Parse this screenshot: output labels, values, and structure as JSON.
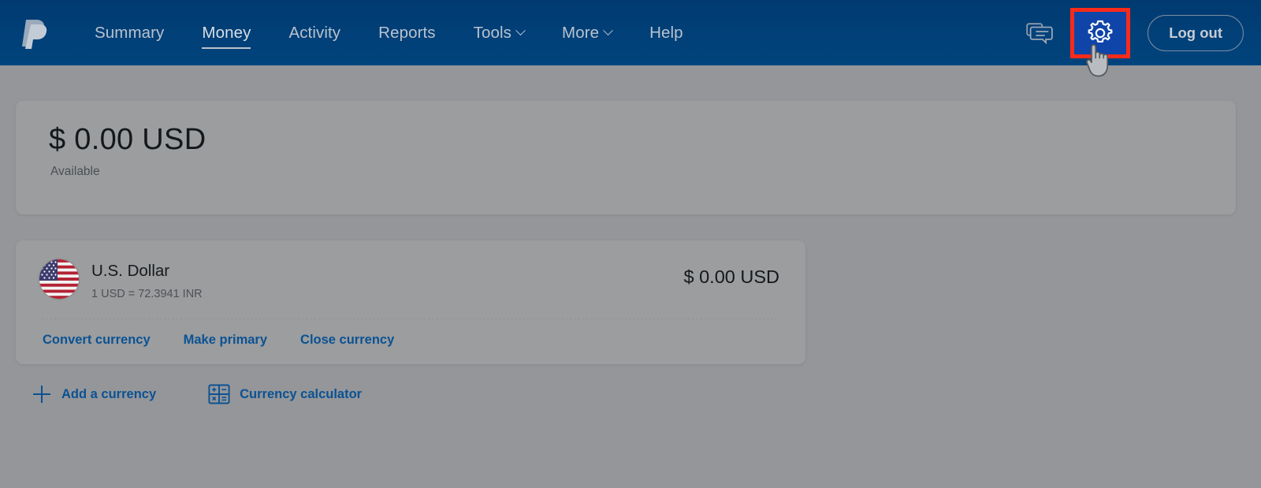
{
  "brand": {
    "logo_name": "paypal-logo",
    "header_bg": "#01437c",
    "link_blue": "#0b5294",
    "highlight_red": "#fb2b19",
    "gear_highlight_bg": "#0f44a8"
  },
  "nav": {
    "items": [
      {
        "label": "Summary",
        "active": false,
        "has_caret": false
      },
      {
        "label": "Money",
        "active": true,
        "has_caret": false
      },
      {
        "label": "Activity",
        "active": false,
        "has_caret": false
      },
      {
        "label": "Reports",
        "active": false,
        "has_caret": false
      },
      {
        "label": "Tools",
        "active": false,
        "has_caret": true
      },
      {
        "label": "More",
        "active": false,
        "has_caret": true
      },
      {
        "label": "Help",
        "active": false,
        "has_caret": false
      }
    ]
  },
  "header_right": {
    "messages_icon": "messages-icon",
    "settings_icon": "gear-icon",
    "logout_label": "Log out"
  },
  "balance": {
    "amount": "$ 0.00 USD",
    "label": "Available"
  },
  "currency": {
    "flag_icon": "us-flag-icon",
    "name": "U.S. Dollar",
    "rate": "1 USD = 72.3941 INR",
    "amount": "$ 0.00 USD",
    "links": [
      {
        "label": "Convert currency"
      },
      {
        "label": "Make primary"
      },
      {
        "label": "Close currency"
      }
    ]
  },
  "bottom_actions": [
    {
      "label": "Add a currency",
      "icon": "plus-icon"
    },
    {
      "label": "Currency calculator",
      "icon": "calculator-icon"
    }
  ],
  "cursor": {
    "type": "pointer-hand-cursor"
  }
}
